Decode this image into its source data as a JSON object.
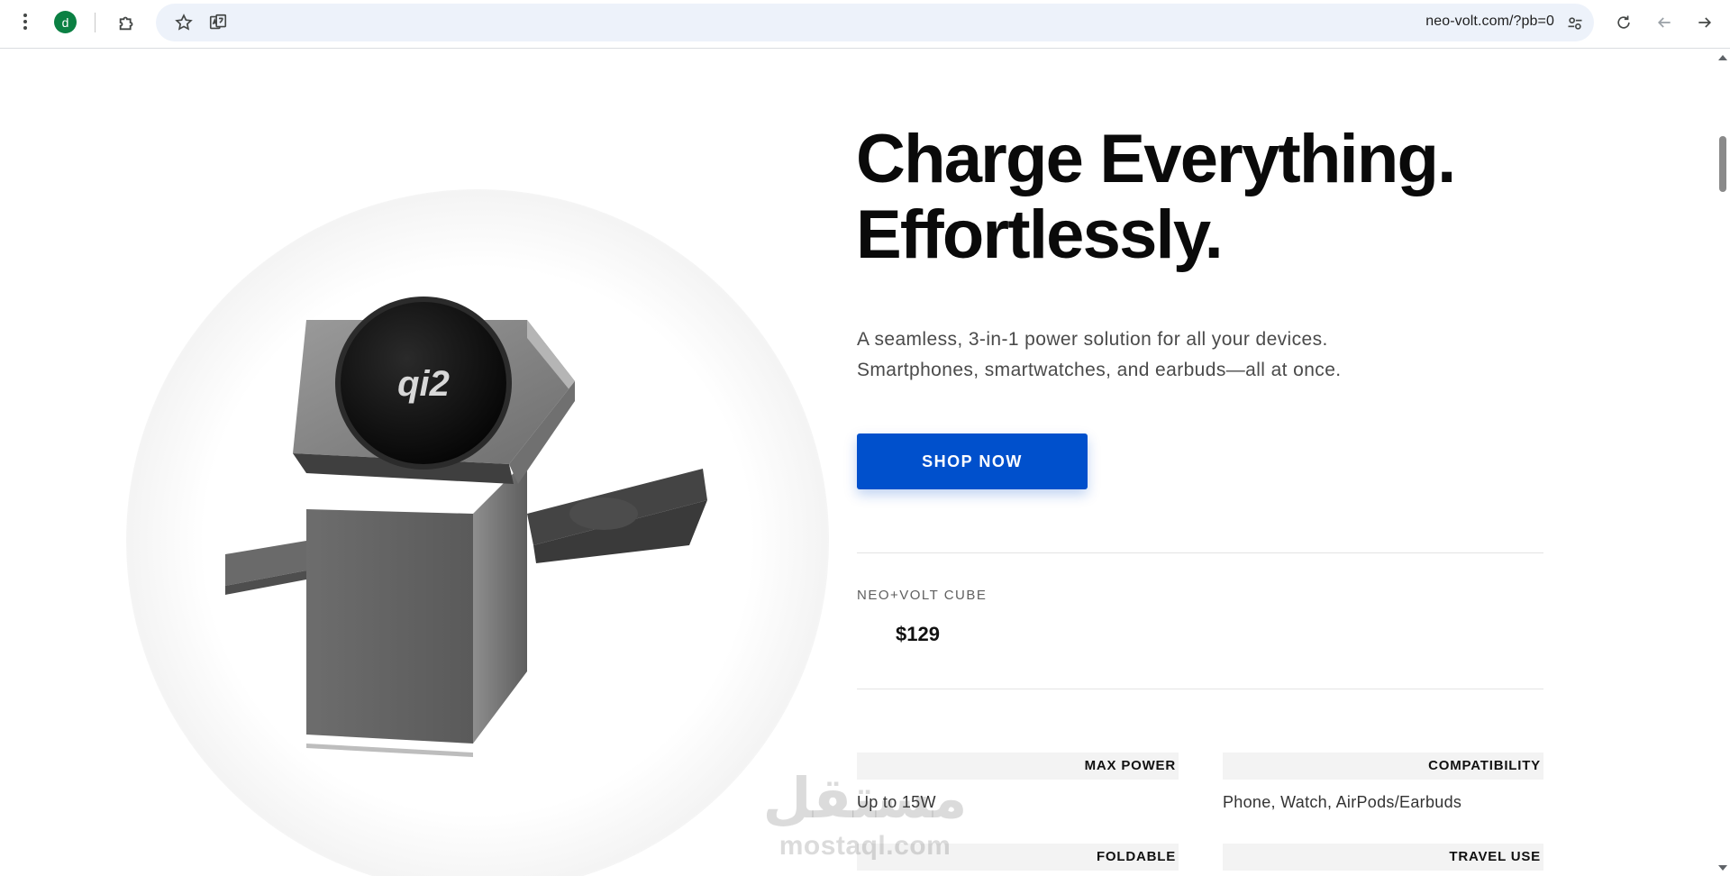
{
  "browser": {
    "profile_initial": "d",
    "url": "neo-volt.com/?pb=0",
    "icons": [
      "kebab-menu-icon",
      "extension-icon",
      "star-icon",
      "translate-icon",
      "site-settings-icon",
      "reload-icon",
      "back-icon",
      "forward-icon"
    ]
  },
  "hero": {
    "headline_line1": "Charge Everything.",
    "headline_line2": "Effortlessly.",
    "subcopy_line1": "A seamless, 3-in-1 power solution for all your devices.",
    "subcopy_line2": "Smartphones, smartwatches, and earbuds—all at once.",
    "cta_label": "SHOP NOW",
    "product_logo": "qi2"
  },
  "product": {
    "name": "NEO+VOLT CUBE",
    "price": "$129"
  },
  "specs": [
    {
      "label": "MAX POWER",
      "value": "Up to 15W"
    },
    {
      "label": "COMPATIBILITY",
      "value": "Phone, Watch, AirPods/Earbuds"
    },
    {
      "label": "FOLDABLE",
      "value": ""
    },
    {
      "label": "TRAVEL USE",
      "value": ""
    }
  ],
  "watermark": {
    "arabic": "مستقل",
    "latin": "mostaql.com"
  },
  "colors": {
    "accent": "#0050cc",
    "headline": "#0a0a0a",
    "profile": "#0b8043"
  }
}
